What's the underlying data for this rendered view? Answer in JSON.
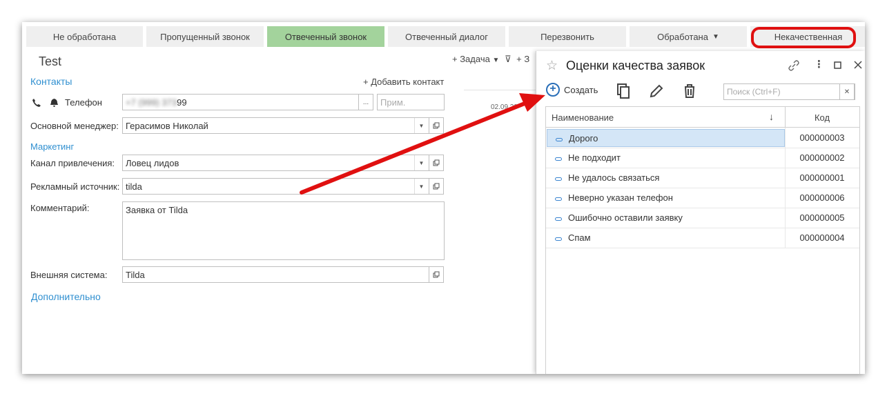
{
  "tabs": [
    {
      "label": "Не обработана"
    },
    {
      "label": "Пропущенный звонок"
    },
    {
      "label": "Отвеченный звонок"
    },
    {
      "label": "Отвеченный диалог"
    },
    {
      "label": "Перезвонить"
    },
    {
      "label": "Обработана",
      "has_dropdown": true
    },
    {
      "label": "Некачественная"
    }
  ],
  "form": {
    "title": "Test",
    "contacts_label": "Контакты",
    "add_contact": "+ Добавить контакт",
    "phone_label": "Телефон",
    "phone_value_blurred": "+7 (999) 373",
    "phone_value_tail": "99",
    "phone_ellipsis": "...",
    "note_placeholder": "Прим.",
    "manager_label": "Основной менеджер:",
    "manager_value": "Герасимов Николай",
    "marketing_label": "Маркетинг",
    "channel_label": "Канал привлечения:",
    "channel_value": "Ловец лидов",
    "source_label": "Рекламный источник:",
    "source_value": "tilda",
    "comment_label": "Комментарий:",
    "comment_value": "Заявка от Tilda",
    "external_label": "Внешняя система:",
    "external_value": "Tilda",
    "more_label": "Дополнительно"
  },
  "side": {
    "task_label": "+ Задача",
    "add_fragment": "+ З",
    "date_fragment": "02.09.20"
  },
  "dialog": {
    "title": "Оценки качества заявок",
    "create_label": "Создать",
    "search_placeholder": "Поиск (Ctrl+F)",
    "col_name": "Наименование",
    "col_code": "Код",
    "sort_icon": "↓",
    "rows": [
      {
        "name": "Дорого",
        "code": "000000003",
        "selected": true
      },
      {
        "name": "Не подходит",
        "code": "000000002"
      },
      {
        "name": "Не удалось связаться",
        "code": "000000001"
      },
      {
        "name": "Неверно указан телефон",
        "code": "000000006"
      },
      {
        "name": "Ошибочно оставили заявку",
        "code": "000000005"
      },
      {
        "name": "Спам",
        "code": "000000004"
      }
    ]
  },
  "colors": {
    "active_tab": "#a3d39c",
    "highlight": "#e01010",
    "link": "#2f8fd0"
  }
}
